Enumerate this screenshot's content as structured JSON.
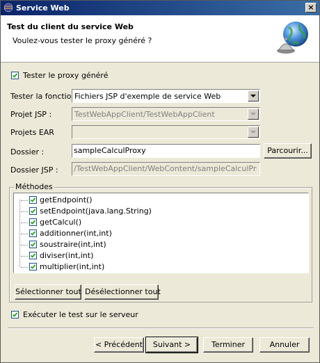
{
  "window": {
    "title": "Service Web",
    "close_label": "×"
  },
  "header": {
    "title": "Test du client du service Web",
    "subtitle": "Voulez-vous tester le proxy généré ?",
    "image_icon": "globe-with-bell-icon"
  },
  "test_proxy": {
    "label": "Tester le proxy généré",
    "checked": true
  },
  "form": {
    "function_label": "Tester la fonction",
    "function_value": "Fichiers JSP d'exemple de service Web",
    "jsp_project_label": "Projet JSP :",
    "jsp_project_value": "TestWebAppClient/TestWebAppClient",
    "ear_projects_label": "Projets EAR",
    "ear_projects_value": "",
    "folder_label": "Dossier :",
    "folder_value": "sampleCalculProxy",
    "browse_label": "Parcourir...",
    "jsp_folder_label": "Dossier JSP :",
    "jsp_folder_value": "/TestWebAppClient/WebContent/sampleCalculProxy"
  },
  "methods": {
    "group_label": "Méthodes",
    "items": [
      {
        "label": "getEndpoint()",
        "checked": true
      },
      {
        "label": "setEndpoint(java.lang.String)",
        "checked": true
      },
      {
        "label": "getCalcul()",
        "checked": true
      },
      {
        "label": "additionner(int,int)",
        "checked": true
      },
      {
        "label": "soustraire(int,int)",
        "checked": true
      },
      {
        "label": "diviser(int,int)",
        "checked": true
      },
      {
        "label": "multiplier(int,int)",
        "checked": true
      }
    ],
    "select_all": "Sélectionner tout",
    "deselect_all": "Désélectionner tout"
  },
  "run_on_server": {
    "label": "Exécuter le test sur le serveur",
    "checked": true
  },
  "buttons": {
    "back": "< Précédent",
    "next": "Suivant >",
    "finish": "Terminer",
    "cancel": "Annuler"
  },
  "colors": {
    "titlebar": "#0a246a",
    "dialog_bg": "#ece9d8",
    "check": "#21a121"
  }
}
